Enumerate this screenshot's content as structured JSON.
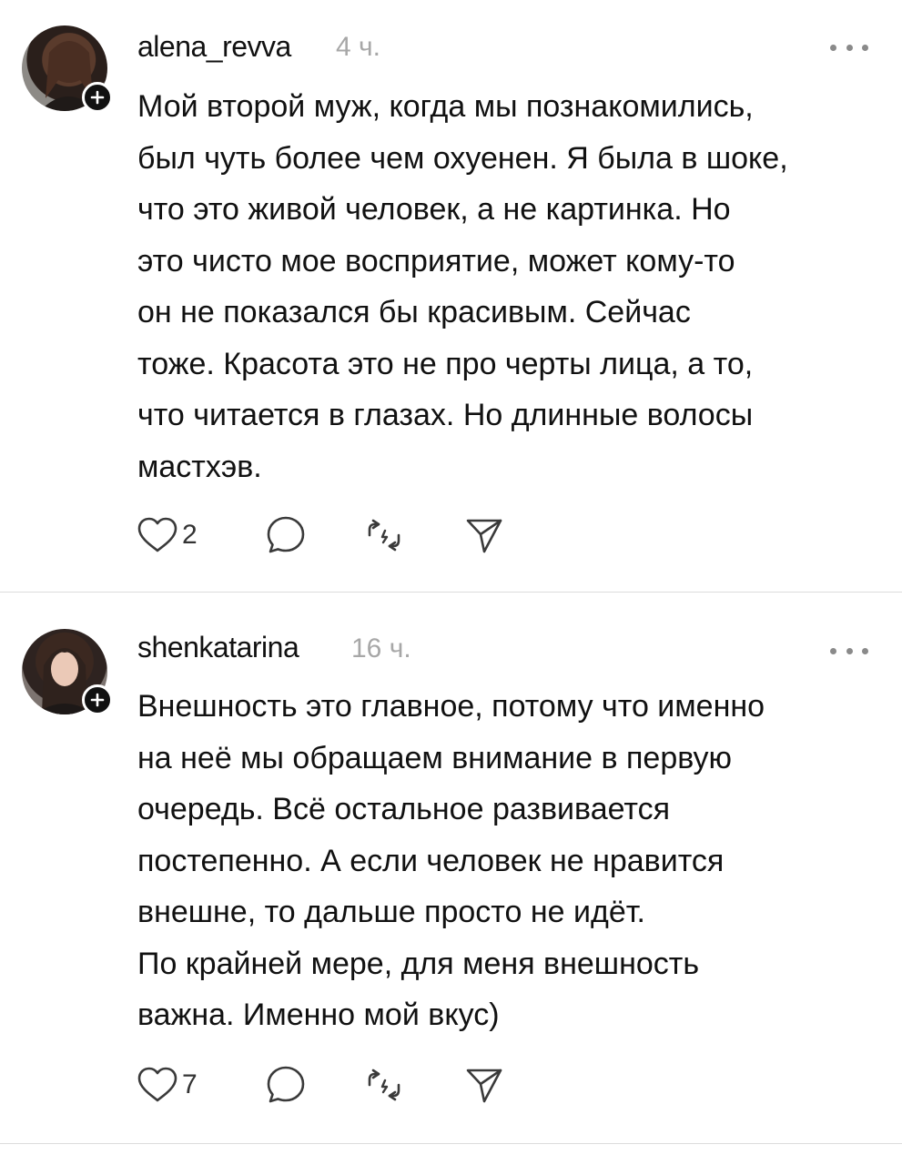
{
  "posts": [
    {
      "username": "alena_revva",
      "time": "4 ч.",
      "text": "Мой второй муж, когда мы познакомились,\nбыл чуть более чем охуенен. Я была в шоке,\nчто это живой человек, а не картинка. Но\nэто чисто мое восприятие, может кому-то\nон не показался бы красивым. Сейчас\nтоже. Красота это не про черты лица, а то,\nчто читается в глазах. Но длинные волосы\nмастхэв.",
      "likes": "2"
    },
    {
      "username": "shenkatarina",
      "time": "16 ч.",
      "text": "Внешность это главное, потому что именно\nна неё мы обращаем внимание в первую\nочередь. Всё остальное развивается\nпостепенно. А если человек не нравится\nвнешне, то дальше просто не идёт.\nПо крайней мере, для меня внешность\nважна. Именно мой вкус)",
      "likes": "7"
    }
  ],
  "icons": {
    "follow": "plus-icon",
    "more": "ellipsis-icon",
    "like": "heart-icon",
    "reply": "comment-bubble-icon",
    "repost": "repost-icon",
    "share": "send-icon"
  }
}
